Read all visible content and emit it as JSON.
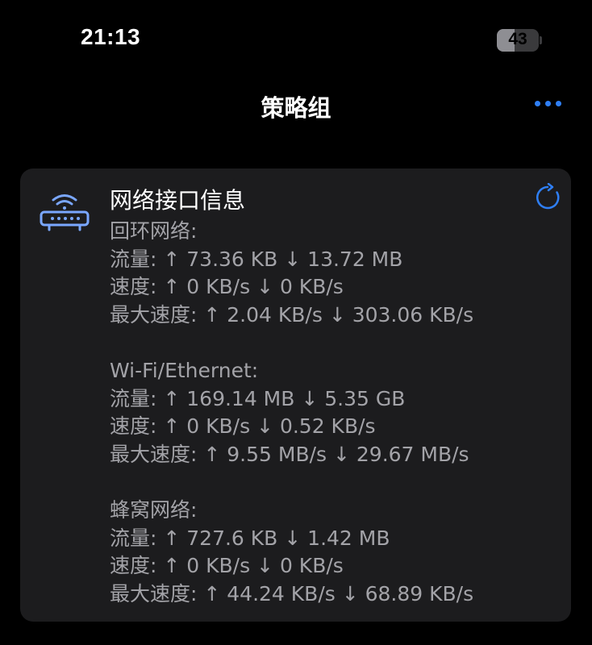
{
  "status_bar": {
    "time": "21:13",
    "battery_level": "43",
    "battery_fraction": 0.43
  },
  "nav": {
    "title": "策略组",
    "more_icon": "ellipsis-icon",
    "accent_color": "#2f7ff5"
  },
  "card": {
    "title": "网络接口信息",
    "leading_icon": "wifi-router-icon",
    "trailing_icon": "refresh-icon",
    "sections": [
      {
        "name": "回环网络:",
        "traffic": "流量: ↑ 73.36 KB ↓ 13.72 MB",
        "speed": "速度: ↑ 0 KB/s ↓ 0 KB/s",
        "max_speed": "最大速度: ↑ 2.04 KB/s ↓ 303.06 KB/s"
      },
      {
        "name": "Wi-Fi/Ethernet:",
        "traffic": "流量: ↑ 169.14 MB ↓ 5.35 GB",
        "speed": "速度: ↑ 0 KB/s ↓ 0.52 KB/s",
        "max_speed": "最大速度: ↑ 9.55 MB/s ↓ 29.67 MB/s"
      },
      {
        "name": "蜂窝网络:",
        "traffic": "流量: ↑ 727.6 KB ↓ 1.42 MB",
        "speed": "速度: ↑ 0 KB/s ↓ 0 KB/s",
        "max_speed": "最大速度: ↑ 44.24 KB/s ↓ 68.89 KB/s"
      }
    ]
  }
}
